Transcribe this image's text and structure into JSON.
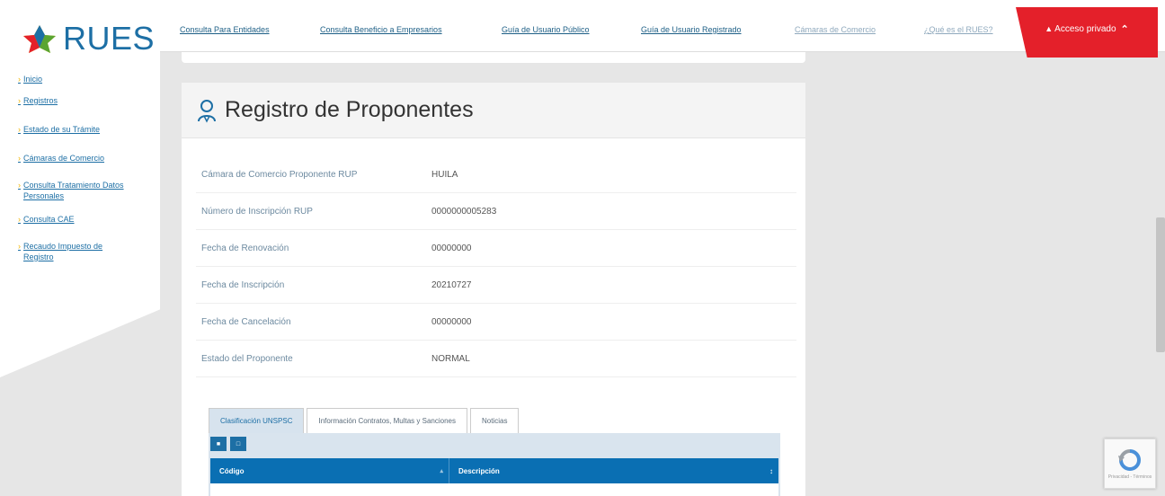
{
  "brand": {
    "name": "RUES",
    "colors": {
      "accent": "#1d6fa5",
      "red": "#e4202a",
      "yellow": "#f2b400",
      "green": "#5aa532"
    }
  },
  "sidebar": {
    "items": [
      {
        "label": "Inicio"
      },
      {
        "label": "Registros"
      },
      {
        "label": "Estado de su Trámite"
      },
      {
        "label": "Cámaras de Comercio"
      },
      {
        "label": "Consulta Tratamiento Datos Personales"
      },
      {
        "label": "Consulta CAE"
      },
      {
        "label": "Recaudo Impuesto de Registro"
      }
    ]
  },
  "topnav": {
    "links": [
      {
        "label": "Consulta Para Entidades"
      },
      {
        "label": "Consulta Beneficio a Empresarios"
      },
      {
        "label": "Guía de Usuario Público"
      },
      {
        "label": "Guía de Usuario Registrado"
      },
      {
        "label": "Cámaras de Comercio"
      },
      {
        "label": "¿Qué es el RUES?"
      }
    ],
    "private_access": "Acceso privado"
  },
  "card": {
    "title": "Registro de Proponentes",
    "rows": [
      {
        "label": "Cámara de Comercio Proponente RUP",
        "value": "HUILA"
      },
      {
        "label": "Número de Inscripción RUP",
        "value": "0000000005283"
      },
      {
        "label": "Fecha de Renovación",
        "value": "00000000"
      },
      {
        "label": "Fecha de Inscripción",
        "value": "20210727"
      },
      {
        "label": "Fecha de Cancelación",
        "value": "00000000"
      },
      {
        "label": "Estado del Proponente",
        "value": "NORMAL"
      }
    ],
    "tabs": [
      {
        "label": "Clasificación UNSPSC"
      },
      {
        "label": "Información Contratos, Multas y Sanciones"
      },
      {
        "label": "Noticias"
      }
    ],
    "grid": {
      "columns": [
        {
          "label": "Código"
        },
        {
          "label": "Descripción"
        }
      ]
    }
  },
  "icons": {
    "tool_1": "filter-icon",
    "tool_2": "export-icon",
    "sort": "sort-icon"
  },
  "recaptcha": {
    "text": "Privacidad - Términos"
  }
}
